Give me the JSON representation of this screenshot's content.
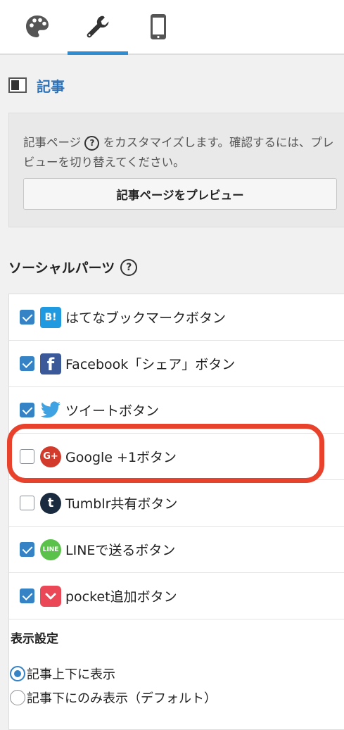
{
  "tabs": [
    {
      "icon": "palette-icon",
      "active": false
    },
    {
      "icon": "wrench-icon",
      "active": true
    },
    {
      "icon": "smartphone-icon",
      "active": false
    }
  ],
  "section": {
    "title": "記事"
  },
  "info": {
    "text_before": "記事ページ",
    "help": "?",
    "text_after": "をカスタマイズします。確認するには、プレビューを切り替えてください。",
    "preview_button": "記事ページをプレビュー"
  },
  "social": {
    "title": "ソーシャルパーツ",
    "help": "?",
    "items": [
      {
        "label": "はてなブックマークボタン",
        "icon_text": "B!",
        "checked": true
      },
      {
        "label": "Facebook「シェア」ボタン",
        "icon_text": "f",
        "checked": true
      },
      {
        "label": "ツイートボタン",
        "icon_text": "",
        "checked": true
      },
      {
        "label": "Google +1ボタン",
        "icon_text": "G+",
        "checked": false
      },
      {
        "label": "Tumblr共有ボタン",
        "icon_text": "t",
        "checked": false
      },
      {
        "label": "LINEで送るボタン",
        "icon_text": "LINE",
        "checked": true
      },
      {
        "label": "pocket追加ボタン",
        "icon_text": "",
        "checked": true
      }
    ]
  },
  "display": {
    "title": "表示設定",
    "options": [
      {
        "label": "記事上下に表示",
        "selected": true
      },
      {
        "label": "記事下にのみ表示（デフォルト）",
        "selected": false
      }
    ]
  },
  "colors": {
    "accent": "#3582c4",
    "highlight": "#e8412c",
    "tab_underline": "#2e8ed3"
  }
}
